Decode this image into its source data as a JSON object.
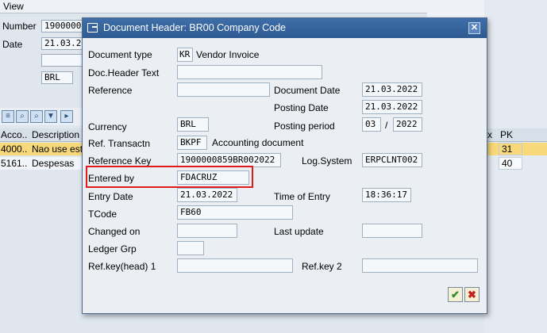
{
  "background": {
    "menu_label": "View",
    "fields": {
      "number_label": "Number",
      "number_value": "1900000",
      "date_label": "Date",
      "date_value": "21.03.2",
      "currency_value": "BRL"
    },
    "grid": {
      "col_account": "Acco..",
      "col_description": "Description",
      "right_col_x": "x",
      "right_col_pk": "PK",
      "rows": [
        {
          "account": "4000..",
          "description": "Nao use est",
          "pk": "31"
        },
        {
          "account": "5161..",
          "description": "Despesas",
          "pk": "40"
        }
      ]
    }
  },
  "dialog": {
    "title": "Document Header: BR00 Company Code",
    "close_glyph": "✕",
    "fields": {
      "document_type_label": "Document type",
      "document_type_code": "KR",
      "document_type_text": "Vendor Invoice",
      "doc_header_text_label": "Doc.Header Text",
      "reference_label": "Reference",
      "document_date_label": "Document Date",
      "document_date_value": "21.03.2022",
      "posting_date_label": "Posting Date",
      "posting_date_value": "21.03.2022",
      "currency_label": "Currency",
      "currency_value": "BRL",
      "posting_period_label": "Posting period",
      "posting_period_month": "03",
      "posting_period_sep": "/",
      "posting_period_year": "2022",
      "ref_transactn_label": "Ref. Transactn",
      "ref_transactn_code": "BKPF",
      "ref_transactn_text": "Accounting document",
      "reference_key_label": "Reference Key",
      "reference_key_value": "1900000859BR002022",
      "log_system_label": "Log.System",
      "log_system_value": "ERPCLNT002",
      "entered_by_label": "Entered by",
      "entered_by_value": "FDACRUZ",
      "entry_date_label": "Entry Date",
      "entry_date_value": "21.03.2022",
      "time_of_entry_label": "Time of Entry",
      "time_of_entry_value": "18:36:17",
      "tcode_label": "TCode",
      "tcode_value": "FB60",
      "changed_on_label": "Changed on",
      "last_update_label": "Last update",
      "ledger_grp_label": "Ledger Grp",
      "ref_key_head1_label": "Ref.key(head) 1",
      "ref_key2_label": "Ref.key 2"
    },
    "buttons": {
      "ok_glyph": "✔",
      "cancel_glyph": "✖"
    },
    "colors": {
      "title_bar": "#2e5a92",
      "highlight": "#e01b1b",
      "ok_check": "#2e8b2e",
      "cancel_x": "#c62020"
    }
  }
}
